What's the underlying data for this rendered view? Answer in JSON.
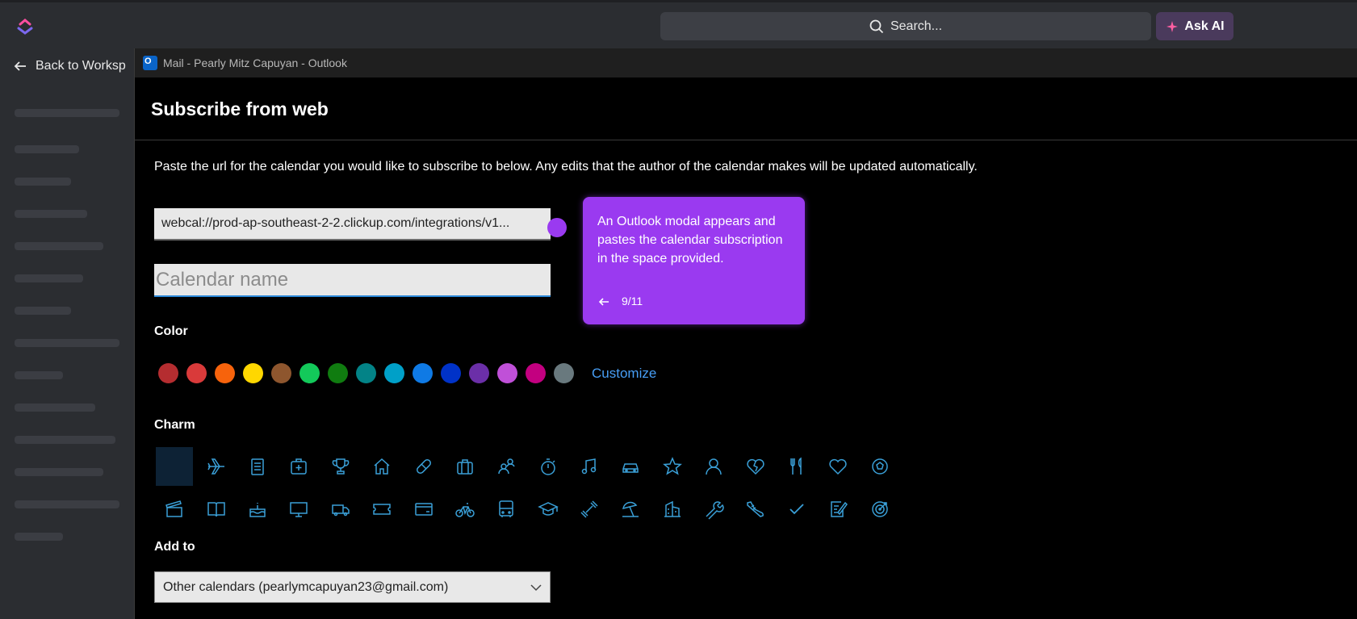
{
  "topbar": {
    "search_placeholder": "Search...",
    "ask_ai_label": "Ask AI"
  },
  "sidebar": {
    "back_label": "Back to Worksp"
  },
  "window": {
    "title": "Mail - Pearly Mitz Capuyan - Outlook"
  },
  "dialog": {
    "heading": "Subscribe from web",
    "description": "Paste the url for the calendar you would like to subscribe to below. Any edits that the author of the calendar makes will be updated automatically.",
    "url_value": "webcal://prod-ap-southeast-2-2.clickup.com/integrations/v1...",
    "calendar_name_placeholder": "Calendar name",
    "color_label": "Color",
    "customize_label": "Customize",
    "charm_label": "Charm",
    "add_to_label": "Add to",
    "add_to_value": "Other calendars (pearlymcapuyan23@gmail.com)"
  },
  "colors": [
    "#b52d30",
    "#d93a3a",
    "#f7630c",
    "#ffd700",
    "#8e562e",
    "#13c95a",
    "#107c10",
    "#038387",
    "#00a0c8",
    "#0f7ae5",
    "#0032c8",
    "#6b2fa8",
    "#c050d8",
    "#c30080",
    "#69797e"
  ],
  "tooltip": {
    "text": "An Outlook modal appears and pastes the calendar subscription in the space provided.",
    "step": "9/11"
  }
}
